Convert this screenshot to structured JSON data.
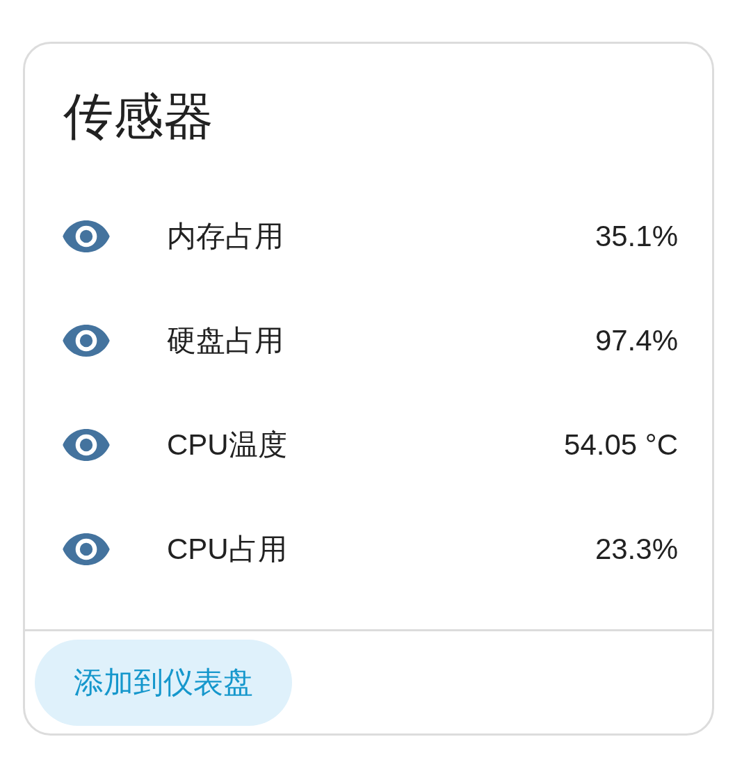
{
  "card": {
    "title": "传感器",
    "entities": [
      {
        "name": "内存占用",
        "state": "35.1%"
      },
      {
        "name": "硬盘占用",
        "state": "97.4%"
      },
      {
        "name": "CPU温度",
        "state": "54.05 °C"
      },
      {
        "name": "CPU占用",
        "state": "23.3%"
      }
    ],
    "actions": [
      {
        "label": "添加到仪表盘"
      }
    ]
  }
}
